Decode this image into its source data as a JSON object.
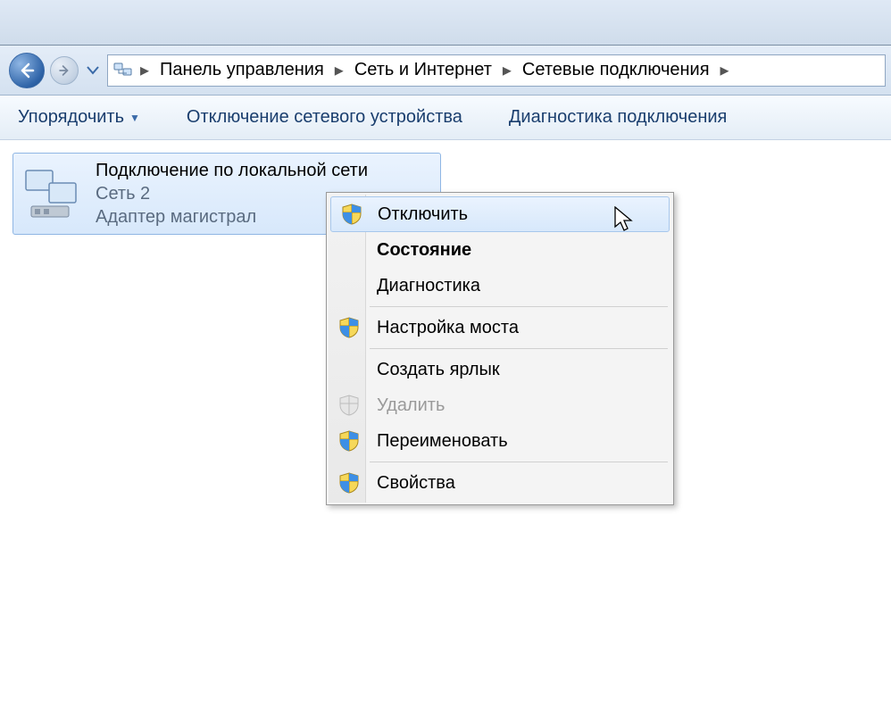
{
  "breadcrumb": {
    "seg1": "Панель управления",
    "seg2": "Сеть и Интернет",
    "seg3": "Сетевые подключения"
  },
  "toolbar": {
    "organize": "Упорядочить",
    "disable_device": "Отключение сетевого устройства",
    "diagnose": "Диагностика подключения"
  },
  "connection": {
    "title": "Подключение по локальной сети",
    "network": "Сеть  2",
    "adapter": "Адаптер магистрал"
  },
  "context_menu": {
    "disable": "Отключить",
    "status": "Состояние",
    "diagnose": "Диагностика",
    "bridge": "Настройка моста",
    "shortcut": "Создать ярлык",
    "delete": "Удалить",
    "rename": "Переименовать",
    "properties": "Свойства"
  }
}
